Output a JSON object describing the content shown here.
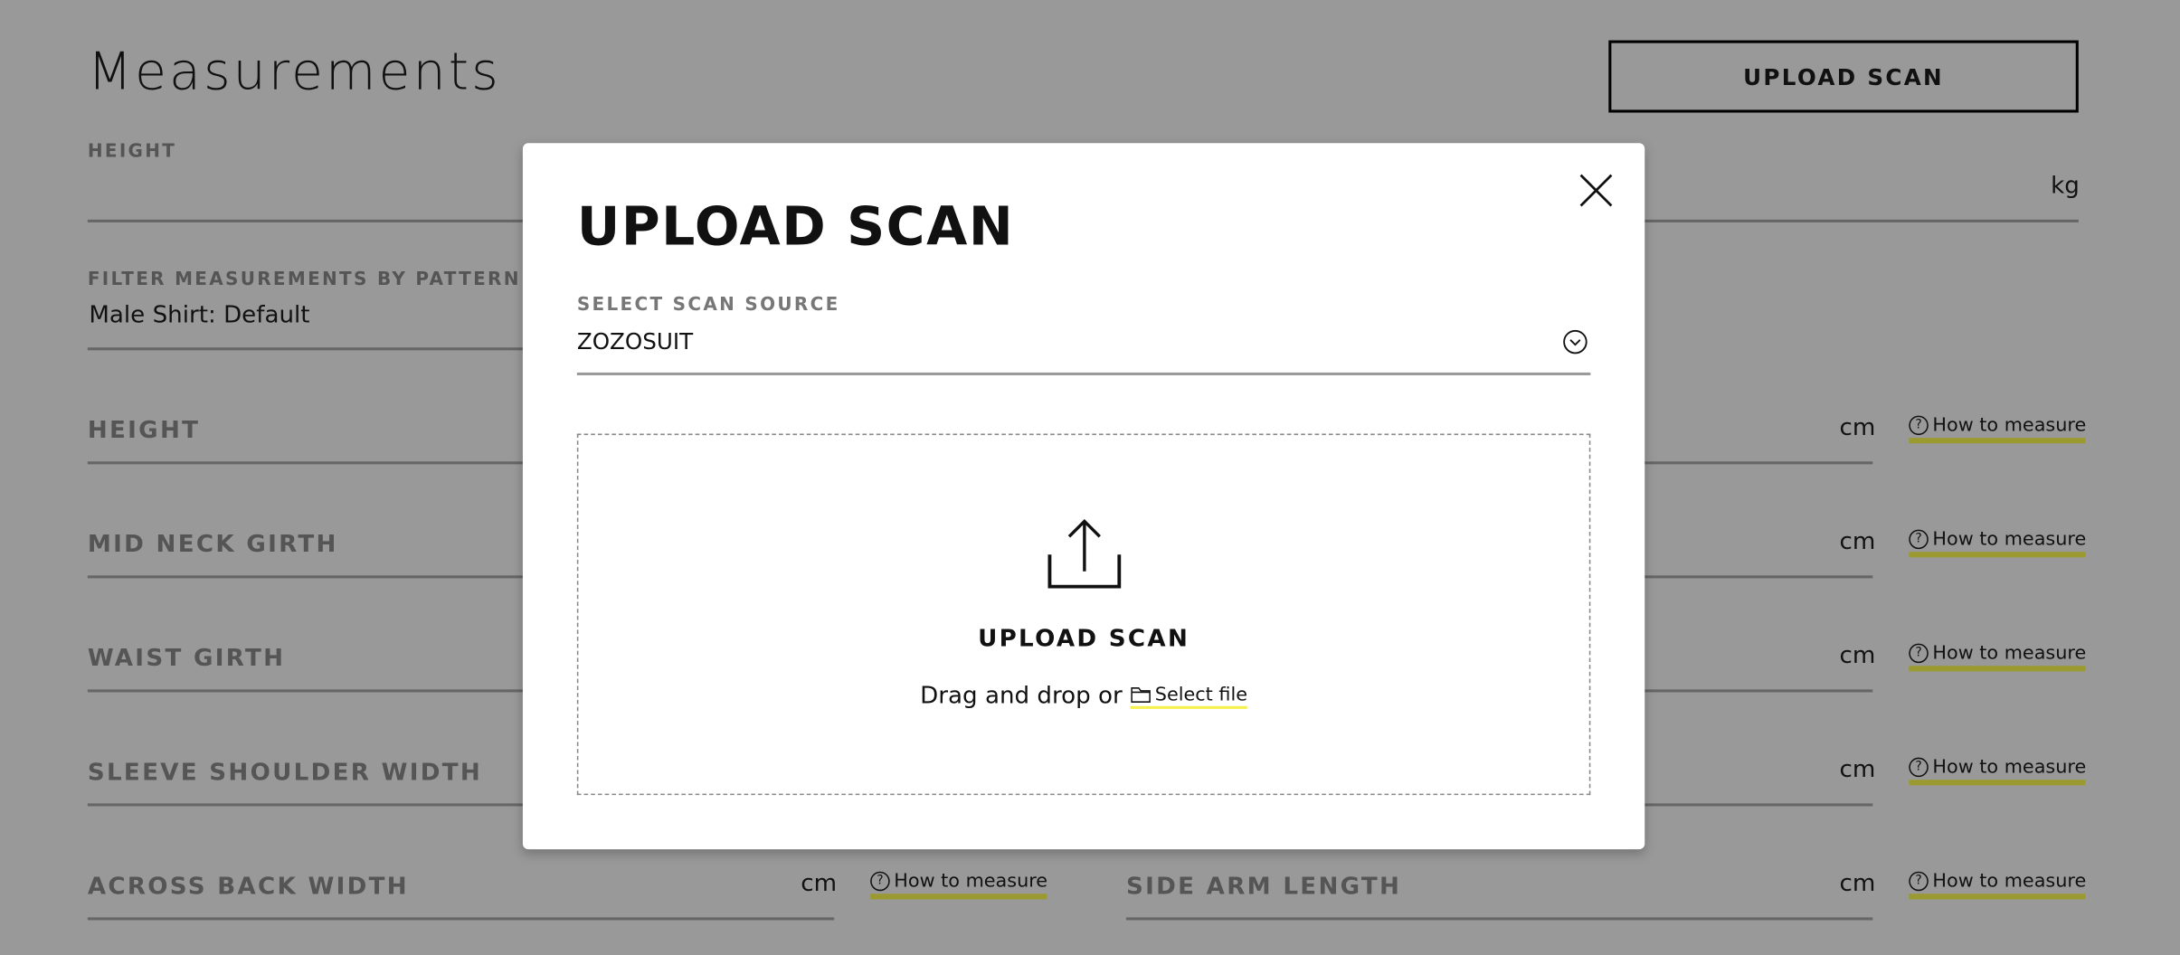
{
  "page": {
    "title": "Measurements",
    "upload_button": "UPLOAD SCAN",
    "height_field": {
      "label": "HEIGHT",
      "unit": "kg"
    },
    "filter": {
      "label": "FILTER MEASUREMENTS BY PATTERN",
      "value": "Male Shirt: Default"
    },
    "how_to_measure": "How to measure",
    "rows": [
      {
        "label": "HEIGHT",
        "unit": "cm"
      },
      {
        "label": "MID NECK GIRTH",
        "unit": "cm"
      },
      {
        "label": "WAIST GIRTH",
        "unit": "cm"
      },
      {
        "label": "SLEEVE SHOULDER WIDTH",
        "unit": "cm"
      }
    ],
    "last_row": [
      {
        "label": "ACROSS BACK WIDTH",
        "unit": "cm"
      },
      {
        "label": "SIDE ARM LENGTH",
        "unit": "cm"
      }
    ]
  },
  "modal": {
    "title": "UPLOAD SCAN",
    "source_label": "SELECT SCAN SOURCE",
    "source_value": "ZOZOSUIT",
    "drop_title": "UPLOAD SCAN",
    "drop_text": "Drag and drop or",
    "select_file": "Select file"
  },
  "colors": {
    "overlay": "#999999",
    "link_underline": "#f5f04a"
  },
  "icons": [
    "close-icon",
    "chevron-down-circle-icon",
    "upload-icon",
    "folder-icon",
    "question-circle-icon"
  ]
}
